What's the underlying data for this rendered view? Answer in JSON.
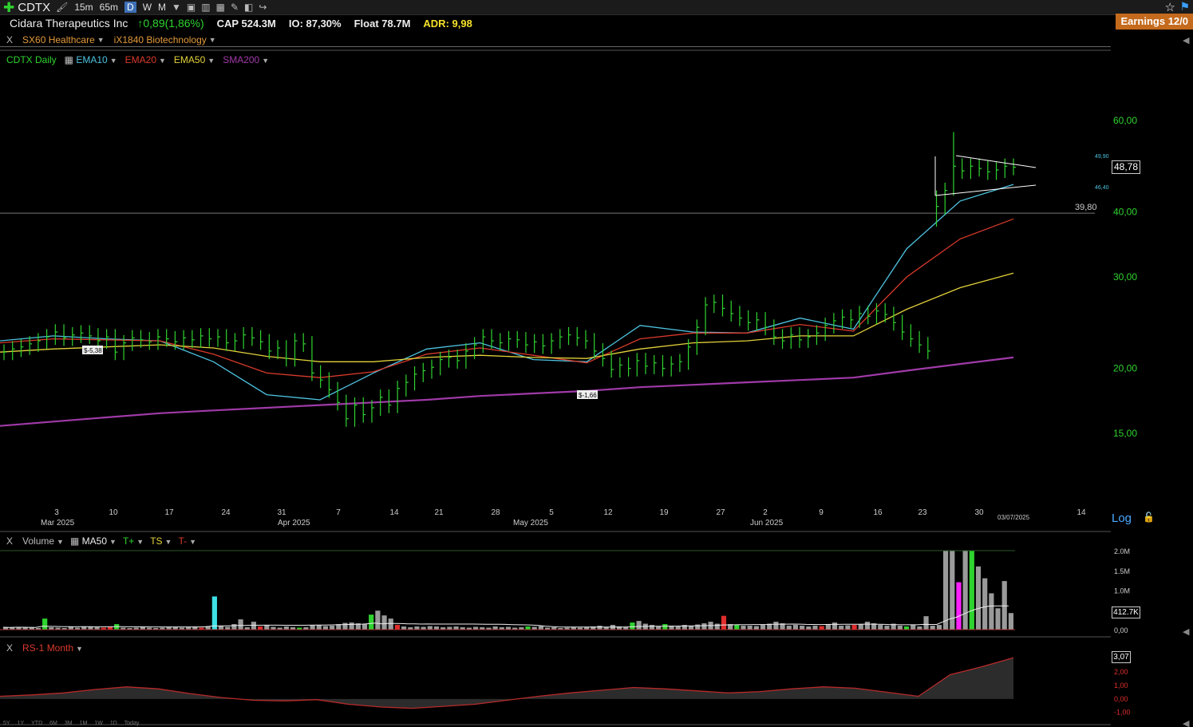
{
  "toolbar": {
    "ticker": "CDTX",
    "timeframes": [
      "15m",
      "65m",
      "D",
      "W",
      "M"
    ],
    "active_timeframe": "D",
    "earnings": "Earnings 12/0"
  },
  "info": {
    "company": "Cidara Therapeutics Inc",
    "change": "↑0,89(1,86%)",
    "cap": "CAP 524.3M",
    "io": "IO: 87,30%",
    "float": "Float 78.7M",
    "adr": "ADR: 9,98"
  },
  "sector": {
    "x": "X",
    "sector": "SX60 Healthcare",
    "industry": "iX1840 Biotechnology"
  },
  "price_panel": {
    "legend": [
      {
        "label": "CDTX Daily",
        "color": "#2fd32f"
      },
      {
        "label": "EMA10",
        "color": "#4ec3e0"
      },
      {
        "label": "EMA20",
        "color": "#d93a2b"
      },
      {
        "label": "EMA50",
        "color": "#e3d23a"
      },
      {
        "label": "SMA200",
        "color": "#a03aa8"
      }
    ],
    "last_price": "48,78",
    "line_label": "39,80",
    "triangle_top": "49,90",
    "triangle_bottom": "46,40",
    "annotations": [
      "$-5,38",
      "$-1,66"
    ],
    "date_end": "03/07/2025",
    "log": "Log"
  },
  "volume_panel": {
    "x": "X",
    "legend": [
      {
        "label": "Volume",
        "color": "#bbbbbb"
      },
      {
        "label": "MA50",
        "color": "#eeeeee"
      },
      {
        "label": "T+",
        "color": "#2fd32f"
      },
      {
        "label": "TS",
        "color": "#e3d23a"
      },
      {
        "label": "T-",
        "color": "#d93a2b"
      }
    ],
    "last_value": "412.7K",
    "axis_ticks": [
      "2.0M",
      "1.5M",
      "1.0M",
      "0,00"
    ]
  },
  "rs_panel": {
    "x": "X",
    "legend": "RS-1 Month",
    "last_value": "3,07",
    "axis_ticks": [
      "2,00",
      "1,00",
      "0,00",
      "-1,00"
    ]
  },
  "bottom_timeframes": [
    "5Y",
    "1Y",
    "YTD",
    "6M",
    "3M",
    "1M",
    "1W",
    "1D",
    "Today"
  ],
  "chart_data": {
    "type": "bar",
    "title": "CDTX Daily",
    "y_axis": {
      "scale": "log",
      "ticks": [
        "60,00",
        "40,00",
        "30,00",
        "20,00",
        "15,00"
      ],
      "tick_values": [
        60,
        40,
        30,
        20,
        15
      ]
    },
    "x_axis": {
      "day_labels": [
        "3",
        "10",
        "17",
        "24",
        "31",
        "7",
        "14",
        "21",
        "28",
        "5",
        "12",
        "19",
        "27",
        "2",
        "9",
        "16",
        "23",
        "30",
        "14"
      ],
      "month_labels": [
        "Mar 2025",
        "Apr 2025",
        "May 2025",
        "Jun 2025"
      ]
    },
    "ohlc_close": [
      21.5,
      21.8,
      22.0,
      22.3,
      22.6,
      23.0,
      23.5,
      22.9,
      23.2,
      23.4,
      23.1,
      22.6,
      23.0,
      21.5,
      22.4,
      22.9,
      22.7,
      22.5,
      23.0,
      22.8,
      22.5,
      22.9,
      22.7,
      23.1,
      22.8,
      23.0,
      22.4,
      22.6,
      23.2,
      22.9,
      22.5,
      21.6,
      21.9,
      20.9,
      22.6,
      22.3,
      19.6,
      19.0,
      18.2,
      17.2,
      16.0,
      17.0,
      16.3,
      16.8,
      17.6,
      17.0,
      18.3,
      18.8,
      19.5,
      19.8,
      20.1,
      20.8,
      21.0,
      20.7,
      21.6,
      22.2,
      23.0,
      22.6,
      22.4,
      22.8,
      22.7,
      22.2,
      22.5,
      22.1,
      22.6,
      23.0,
      23.2,
      22.9,
      22.6,
      21.6,
      20.9,
      19.9,
      20.3,
      20.0,
      20.7,
      20.2,
      20.5,
      20.0,
      20.4,
      20.6,
      22.0,
      24.0,
      26.5,
      26.8,
      26.1,
      25.5,
      25.0,
      24.5,
      24.8,
      24.0,
      23.0,
      22.6,
      23.2,
      22.7,
      23.0,
      23.4,
      24.2,
      24.7,
      25.1,
      24.8,
      25.5,
      25.2,
      25.8,
      25.4,
      24.5,
      23.5,
      22.8,
      22.2,
      21.6,
      41.0,
      44.0,
      49.0,
      48.0,
      49.0,
      48.5,
      47.8,
      48.2,
      49.0,
      48.78
    ],
    "series": [
      {
        "name": "EMA10",
        "values": [
          22.6,
          23.1,
          22.8,
          22.6,
          20.6,
          17.8,
          17.4,
          19.6,
          21.8,
          22.4,
          20.8,
          20.6,
          24.2,
          23.5,
          23.4,
          25.0,
          23.8,
          34.0,
          42.0,
          45.2
        ]
      },
      {
        "name": "EMA20",
        "values": [
          22.4,
          22.8,
          22.7,
          22.6,
          21.3,
          19.6,
          19.2,
          19.7,
          21.3,
          21.9,
          21.2,
          20.5,
          22.8,
          23.4,
          23.4,
          24.3,
          23.6,
          30.0,
          35.5,
          38.8
        ]
      },
      {
        "name": "EMA50",
        "values": [
          21.5,
          21.8,
          22.0,
          22.2,
          21.9,
          21.1,
          20.6,
          20.6,
          21.0,
          21.2,
          21.0,
          20.9,
          21.8,
          22.4,
          22.6,
          23.1,
          23.1,
          26.0,
          28.6,
          30.5
        ]
      },
      {
        "name": "SMA200",
        "values": [
          15.5,
          15.8,
          16.1,
          16.4,
          16.6,
          16.8,
          17.0,
          17.2,
          17.4,
          17.7,
          17.9,
          18.1,
          18.4,
          18.6,
          18.8,
          19.0,
          19.2,
          19.8,
          20.4,
          21.0
        ]
      }
    ],
    "volume_m": [
      0.06,
      0.05,
      0.07,
      0.06,
      0.05,
      0.04,
      0.28,
      0.06,
      0.05,
      0.04,
      0.07,
      0.05,
      0.08,
      0.08,
      0.06,
      0.05,
      0.07,
      0.14,
      0.05,
      0.04,
      0.05,
      0.06,
      0.05,
      0.04,
      0.05,
      0.06,
      0.07,
      0.05,
      0.06,
      0.08,
      0.05,
      0.09,
      0.84,
      0.1,
      0.07,
      0.14,
      0.26,
      0.06,
      0.2,
      0.08,
      0.12,
      0.07,
      0.05,
      0.08,
      0.06,
      0.05,
      0.06,
      0.11,
      0.12,
      0.09,
      0.1,
      0.14,
      0.17,
      0.18,
      0.16,
      0.15,
      0.38,
      0.48,
      0.36,
      0.28,
      0.12,
      0.08,
      0.06,
      0.08,
      0.07,
      0.09,
      0.08,
      0.06,
      0.07,
      0.08,
      0.06,
      0.05,
      0.07,
      0.06,
      0.05,
      0.08,
      0.06,
      0.07,
      0.05,
      0.06,
      0.08,
      0.07,
      0.09,
      0.05,
      0.06,
      0.04,
      0.05,
      0.06,
      0.05,
      0.07,
      0.08,
      0.1,
      0.07,
      0.12,
      0.08,
      0.06,
      0.18,
      0.22,
      0.15,
      0.12,
      0.08,
      0.14,
      0.1,
      0.08,
      0.12,
      0.1,
      0.13,
      0.16,
      0.2,
      0.15,
      0.35,
      0.14,
      0.12,
      0.1,
      0.1,
      0.09,
      0.12,
      0.15,
      0.2,
      0.16,
      0.1,
      0.12,
      0.1,
      0.08,
      0.1,
      0.09,
      0.14,
      0.18,
      0.1,
      0.11,
      0.12,
      0.14,
      0.2,
      0.16,
      0.12,
      0.1,
      0.15,
      0.1,
      0.08,
      0.12,
      0.08,
      0.34,
      0.1,
      0.12,
      2.0,
      2.0,
      1.2,
      2.0,
      2.0,
      1.6,
      1.3,
      0.92,
      0.54,
      1.23,
      0.42
    ],
    "rs": [
      0.2,
      0.3,
      0.45,
      0.7,
      0.9,
      0.75,
      0.4,
      0.1,
      -0.1,
      -0.15,
      -0.05,
      -0.4,
      -0.6,
      -0.7,
      -0.55,
      -0.4,
      -0.1,
      0.2,
      0.45,
      0.65,
      0.85,
      0.75,
      0.6,
      0.45,
      0.55,
      0.75,
      0.9,
      0.8,
      0.5,
      0.2,
      1.8,
      2.4,
      3.07
    ]
  }
}
